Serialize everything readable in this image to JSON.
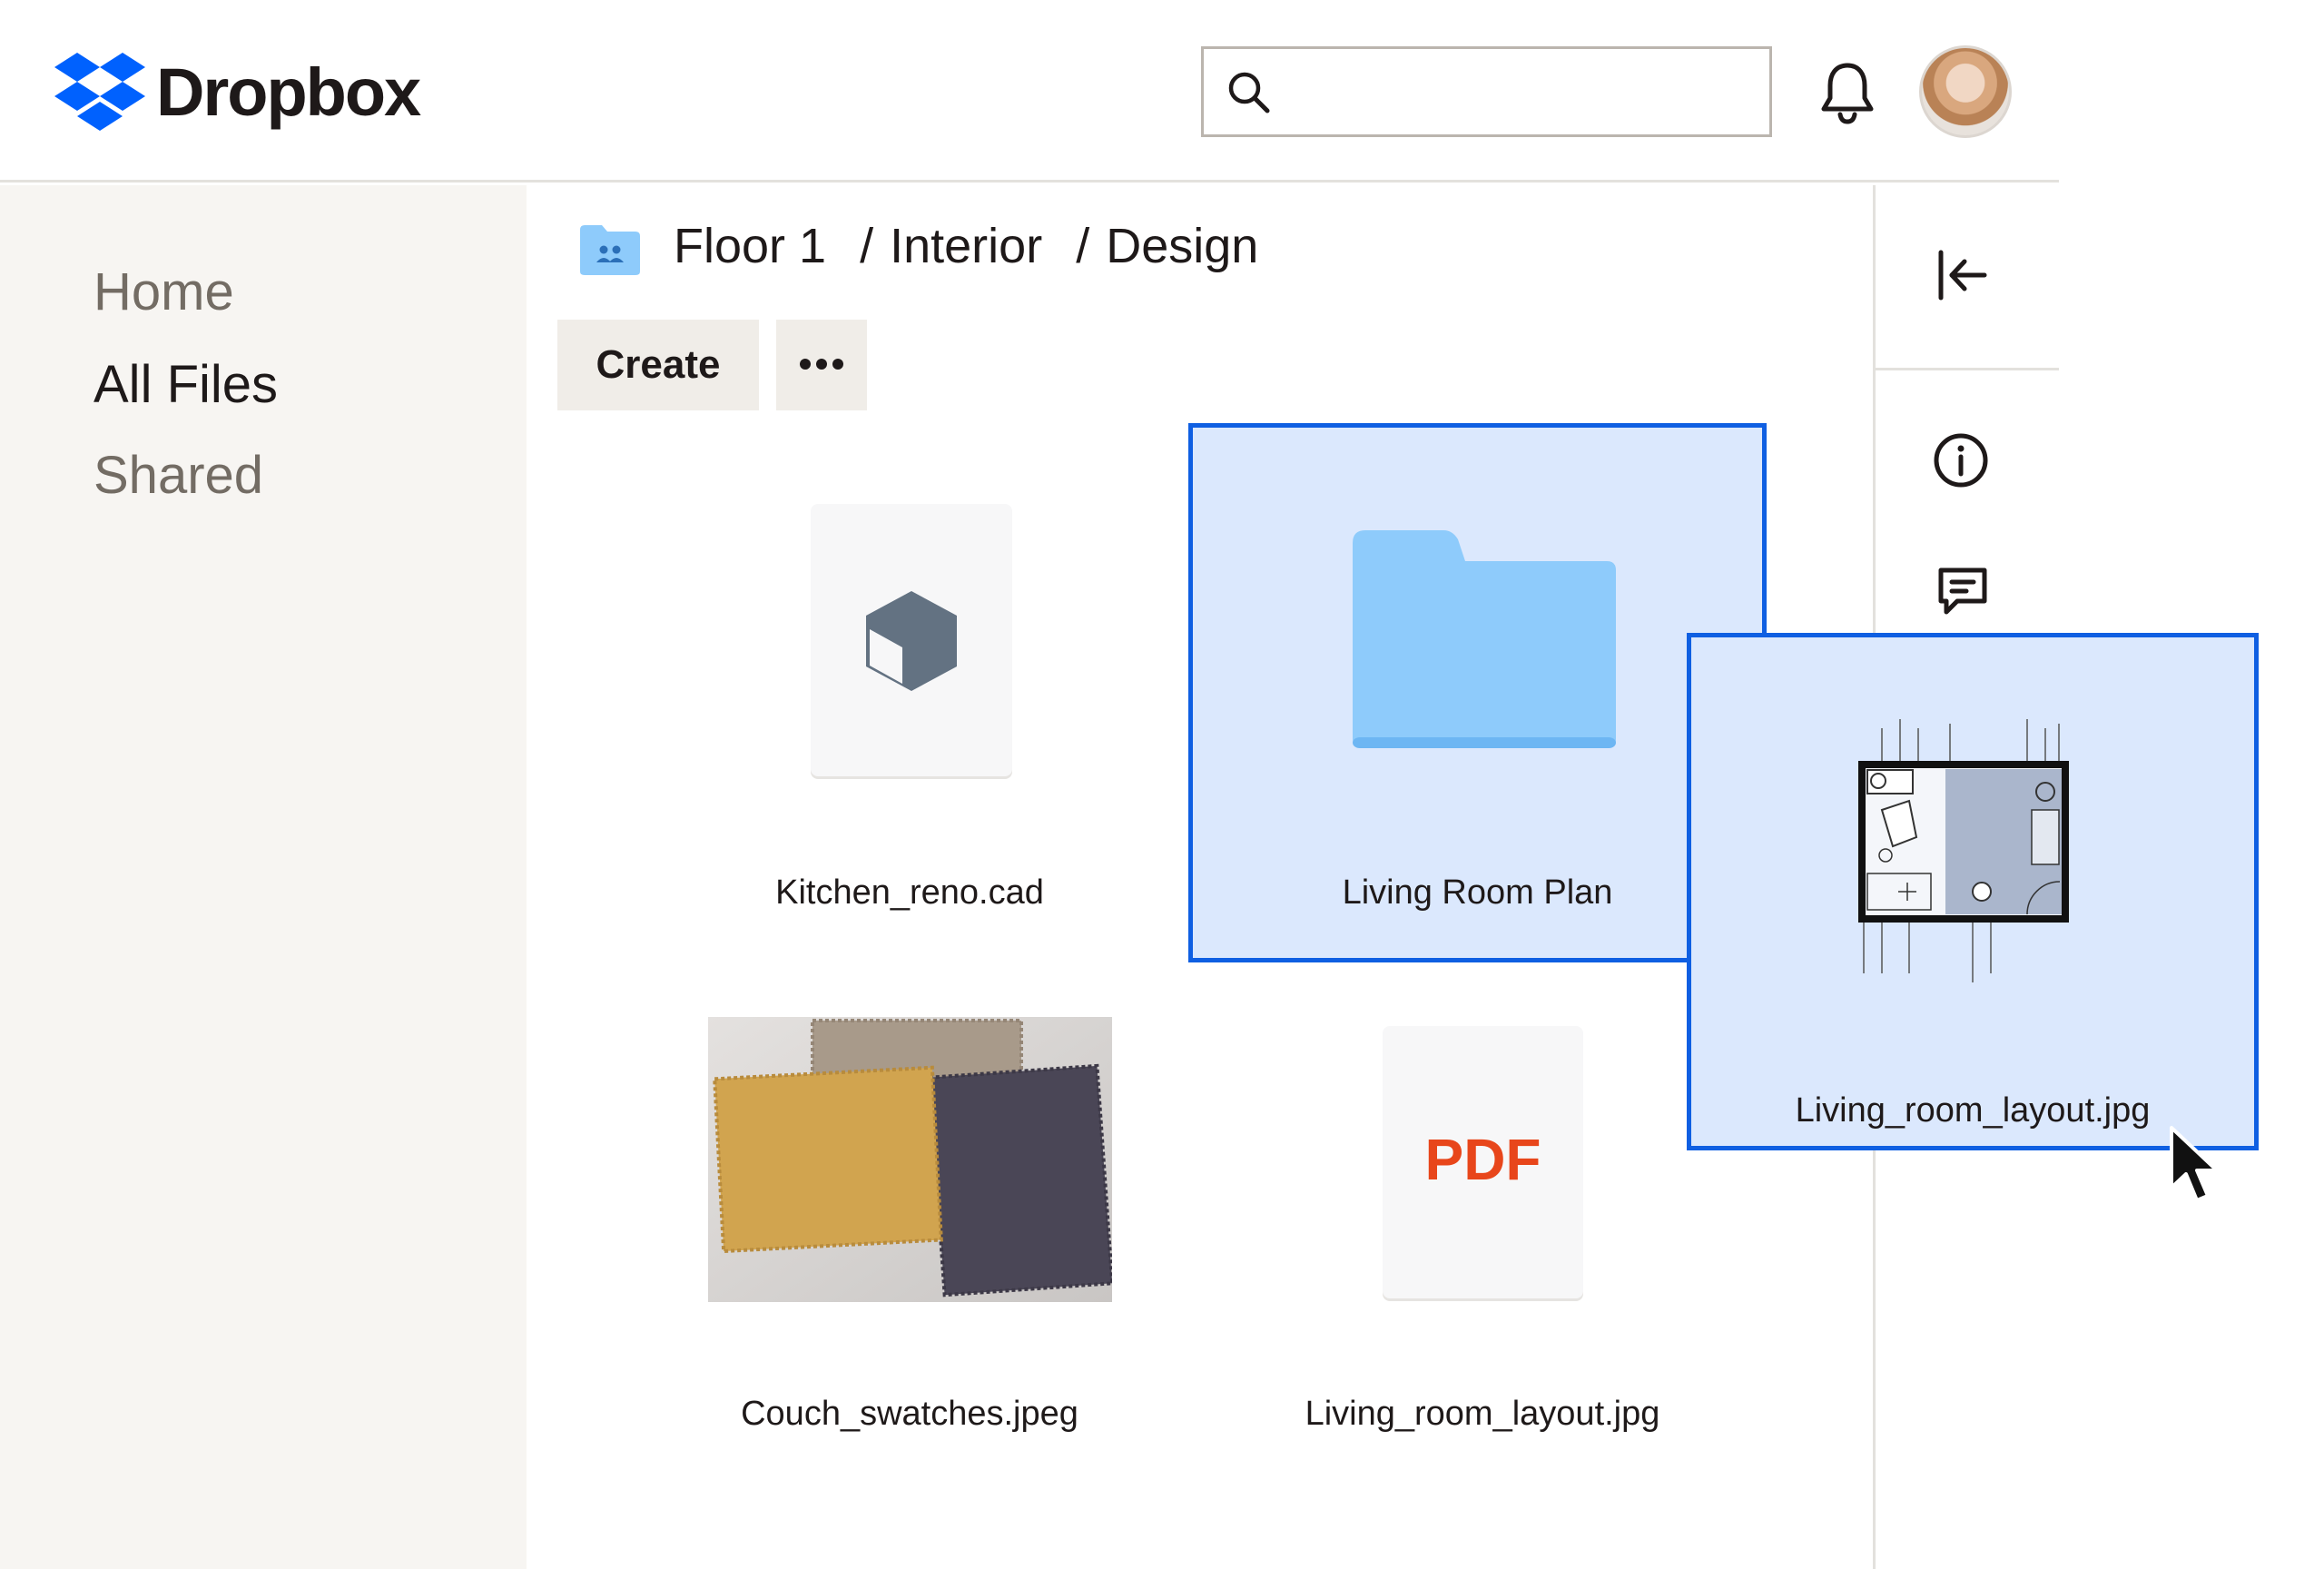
{
  "header": {
    "logo_text": "Dropbox",
    "search": {
      "value": "",
      "placeholder": ""
    },
    "icons": [
      "dropbox-logo-icon",
      "search-icon",
      "bell-icon",
      "avatar"
    ]
  },
  "sidebar": {
    "items": [
      {
        "label": "Home",
        "active": false
      },
      {
        "label": "All Files",
        "active": true
      },
      {
        "label": "Shared",
        "active": false
      }
    ]
  },
  "breadcrumb": {
    "parts": [
      "Floor 1",
      "Interior",
      "Design"
    ],
    "separator": "/"
  },
  "toolbar": {
    "create_label": "Create",
    "more_icon": "more-horizontal-icon"
  },
  "files": [
    {
      "name": "Kitchen_reno.cad",
      "kind": "cad",
      "selected": false
    },
    {
      "name": "Living Room Plan",
      "kind": "folder",
      "selected": true
    },
    {
      "name": "Couch_swatches.jpeg",
      "kind": "image",
      "selected": false
    },
    {
      "name": "Living_room_layout.jpg",
      "kind": "pdf",
      "badge": "PDF",
      "selected": false
    }
  ],
  "drag": {
    "name": "Living_room_layout.jpg"
  },
  "rail": {
    "icons": [
      "collapse-panel-icon",
      "info-icon",
      "comment-icon"
    ]
  },
  "colors": {
    "selection_border": "#0f5fe2",
    "selection_fill": "#dbe8fd",
    "folder_blue": "#8ecbfb",
    "pdf_red": "#e8461b",
    "sidebar_bg": "#f7f5f2"
  }
}
